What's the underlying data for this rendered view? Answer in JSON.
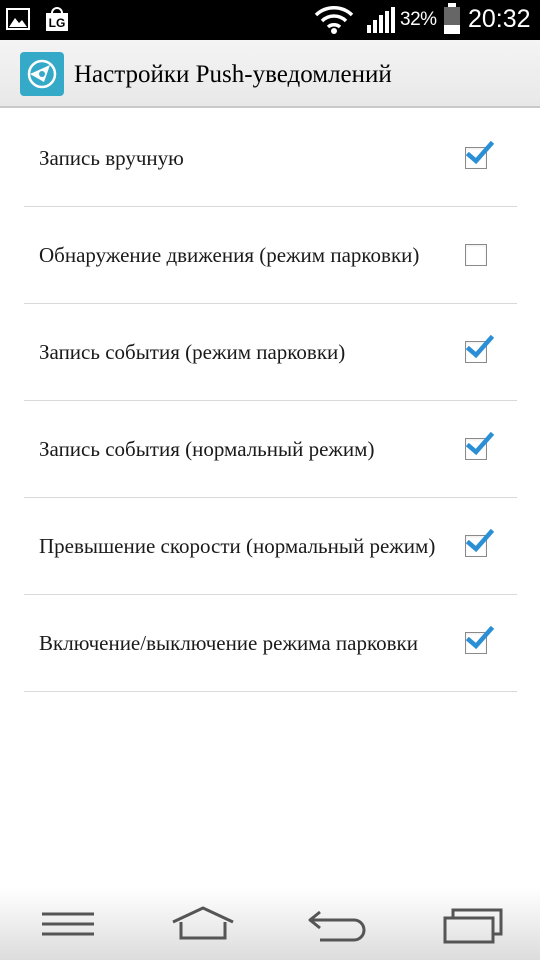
{
  "status_bar": {
    "battery_percent": "32%",
    "time": "20:32",
    "icons": [
      "gallery-icon",
      "lg-icon",
      "wifi-icon",
      "signal-icon",
      "battery-icon"
    ]
  },
  "action_bar": {
    "title": "Настройки Push-уведомлений",
    "icon": "app-compass-icon"
  },
  "settings": [
    {
      "label": "Запись вручную",
      "checked": true
    },
    {
      "label": "Обнаружение движения (режим парковки)",
      "checked": false
    },
    {
      "label": "Запись события (режим парковки)",
      "checked": true
    },
    {
      "label": "Запись события (нормальный режим)",
      "checked": true
    },
    {
      "label": "Превышение скорости (нормальный режим)",
      "checked": true
    },
    {
      "label": "Включение/выключение режима парковки",
      "checked": true
    }
  ],
  "nav_bar": {
    "icons": [
      "menu-icon",
      "home-icon",
      "back-icon",
      "recent-apps-icon"
    ]
  },
  "colors": {
    "status_bar_bg": "#000000",
    "action_bar_bg": "#eeeeee",
    "app_icon_bg": "#35a9c8",
    "checkmark": "#2b8fd6",
    "divider": "#d9d9d9"
  }
}
